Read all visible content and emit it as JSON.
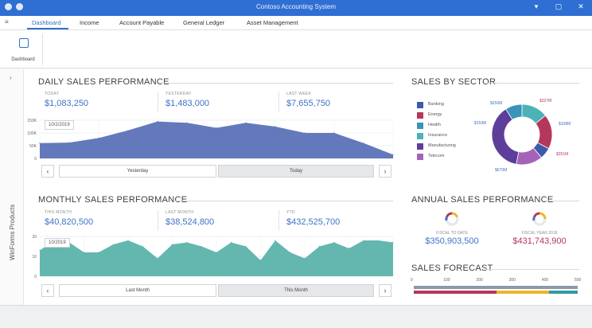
{
  "window": {
    "title": "Contoso Accounting System"
  },
  "menu": {
    "tabs": [
      "Dashboard",
      "Income",
      "Account Payable",
      "General Ledger",
      "Asset Management"
    ]
  },
  "ribbon": {
    "dashboard_label": "Dashboard"
  },
  "sidebar": {
    "vertical_label": "WinForms Products"
  },
  "daily": {
    "title": "DAILY SALES PERFORMANCE",
    "kpis": [
      {
        "label": "TODAY",
        "value": "$1,083,250"
      },
      {
        "label": "YESTERDAY",
        "value": "$1,483,000"
      },
      {
        "label": "LAST WEEK",
        "value": "$7,655,750"
      }
    ],
    "date_badge": "10/2/2019",
    "nav": {
      "prev": "‹",
      "next": "›",
      "left_label": "Yesterday",
      "right_label": "Today",
      "selected": "right"
    }
  },
  "monthly": {
    "title": "MONTHLY SALES PERFORMANCE",
    "kpis": [
      {
        "label": "THIS MONTH",
        "value": "$40,820,500"
      },
      {
        "label": "LAST MONTH",
        "value": "$38,524,800"
      },
      {
        "label": "YTD",
        "value": "$432,525,700"
      }
    ],
    "date_badge": "10/2019",
    "nav": {
      "prev": "‹",
      "next": "›",
      "left_label": "Last Month",
      "right_label": "This Month",
      "selected": "right"
    }
  },
  "sector": {
    "title": "SALES BY SECTOR",
    "legend": [
      {
        "name": "Banking",
        "color": "#3f5aa9"
      },
      {
        "name": "Energy",
        "color": "#b5375d"
      },
      {
        "name": "Health",
        "color": "#3a93b8"
      },
      {
        "name": "Insurance",
        "color": "#4bb3b7"
      },
      {
        "name": "Manufacturing",
        "color": "#5d3e9a"
      },
      {
        "name": "Telecom",
        "color": "#a463b8"
      }
    ],
    "donut_labels": [
      "$250M",
      "$327M",
      "$159M",
      "$108M",
      "$251M",
      "$670M"
    ]
  },
  "annual": {
    "title": "ANNUAL SALES PERFORMANCE",
    "items": [
      {
        "label": "FISCAL TO DATE",
        "value": "$350,903,500",
        "color": "#3d74c6"
      },
      {
        "label": "FISCAL YEAR 2018",
        "value": "$431,743,900",
        "color": "#b5375d"
      }
    ]
  },
  "forecast": {
    "title": "SALES FORECAST",
    "ticks": [
      "0",
      "100",
      "200",
      "300",
      "400",
      "500"
    ]
  },
  "chart_data": [
    {
      "type": "area",
      "name": "daily",
      "ylabel": "",
      "ytick_labels": [
        "0",
        "50K",
        "100K",
        "150K"
      ],
      "ylim": [
        0,
        150000
      ],
      "x": [
        0,
        1,
        2,
        3,
        4,
        5,
        6,
        7,
        8,
        9,
        10,
        11,
        12
      ],
      "values": [
        60000,
        62000,
        80000,
        110000,
        145000,
        140000,
        120000,
        140000,
        125000,
        100000,
        100000,
        60000,
        15000
      ],
      "color": "#5b72b8"
    },
    {
      "type": "area",
      "name": "monthly",
      "ytick_labels": [
        "0",
        "10",
        "20"
      ],
      "ylim": [
        0,
        20
      ],
      "x": [
        0,
        1,
        2,
        3,
        4,
        5,
        6,
        7,
        8,
        9,
        10,
        11,
        12,
        13,
        14,
        15,
        16,
        17,
        18,
        19,
        20,
        21,
        22,
        23,
        24
      ],
      "values": [
        13,
        18,
        17,
        12,
        12,
        16,
        18,
        15,
        9,
        16,
        17,
        15,
        12,
        17,
        15,
        8,
        18,
        12,
        9,
        15,
        17,
        14,
        18,
        18,
        17
      ],
      "color": "#5bb3ab"
    },
    {
      "type": "pie",
      "name": "sector",
      "categories": [
        "Banking",
        "Energy",
        "Health",
        "Insurance",
        "Manufacturing",
        "Telecom"
      ],
      "values": [
        108,
        327,
        159,
        250,
        670,
        251
      ]
    }
  ]
}
